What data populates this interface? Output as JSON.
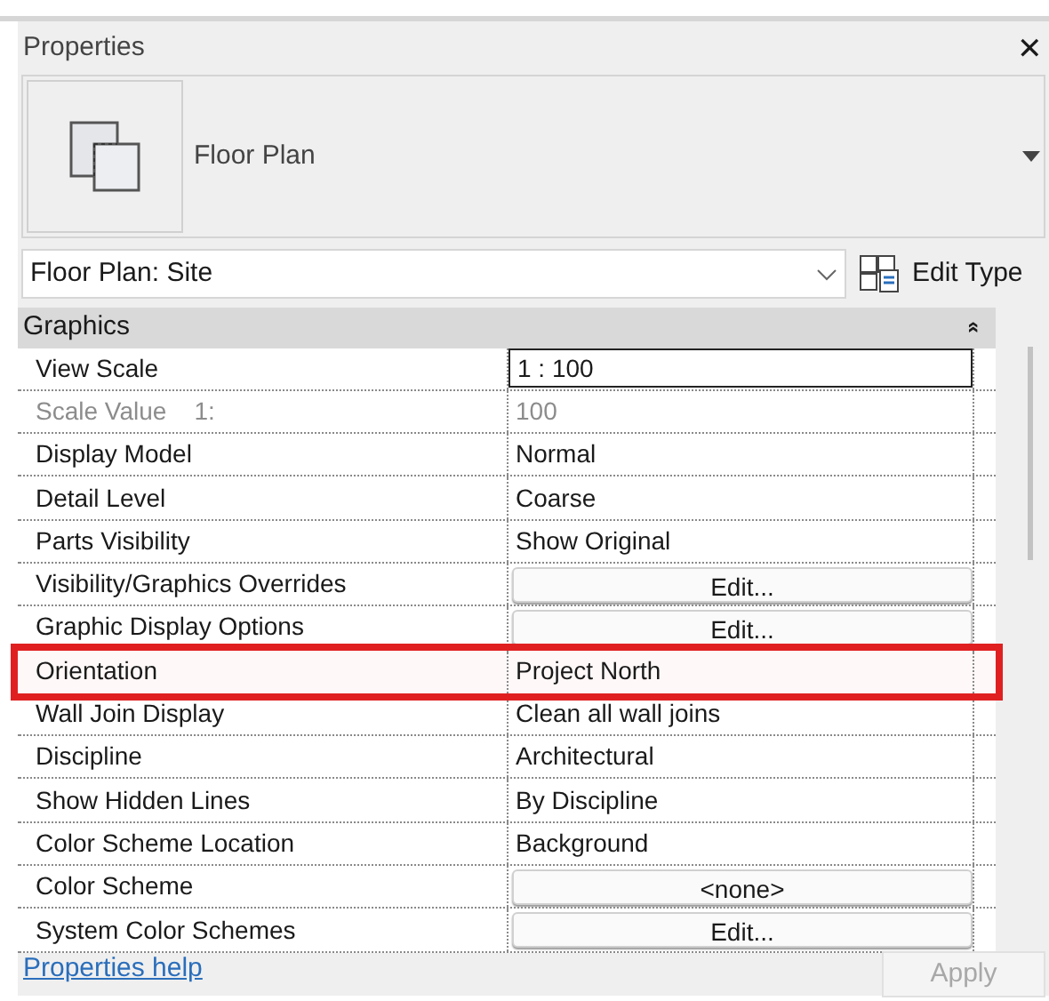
{
  "panel": {
    "title": "Properties",
    "close": "✕"
  },
  "type_selector": {
    "name": "Floor Plan"
  },
  "view_selector": {
    "value": "Floor Plan: Site"
  },
  "edit_type_button": {
    "label": "Edit Type"
  },
  "group": {
    "title": "Graphics",
    "expanded": true,
    "toggle": "»"
  },
  "properties": [
    {
      "name": "View Scale",
      "value": "1 : 100",
      "kind": "field",
      "disabled": false,
      "highlighted": false
    },
    {
      "name": "Scale Value    1:",
      "value": "100",
      "kind": "text",
      "disabled": true,
      "highlighted": false
    },
    {
      "name": "Display Model",
      "value": "Normal",
      "kind": "text",
      "disabled": false,
      "highlighted": false
    },
    {
      "name": "Detail Level",
      "value": "Coarse",
      "kind": "text",
      "disabled": false,
      "highlighted": false
    },
    {
      "name": "Parts Visibility",
      "value": "Show Original",
      "kind": "text",
      "disabled": false,
      "highlighted": false
    },
    {
      "name": "Visibility/Graphics Overrides",
      "value": "Edit...",
      "kind": "button",
      "disabled": false,
      "highlighted": false
    },
    {
      "name": "Graphic Display Options",
      "value": "Edit...",
      "kind": "button",
      "disabled": false,
      "highlighted": false
    },
    {
      "name": "Orientation",
      "value": "Project North",
      "kind": "text",
      "disabled": false,
      "highlighted": true
    },
    {
      "name": "Wall Join Display",
      "value": "Clean all wall joins",
      "kind": "text",
      "disabled": false,
      "highlighted": false
    },
    {
      "name": "Discipline",
      "value": "Architectural",
      "kind": "text",
      "disabled": false,
      "highlighted": false
    },
    {
      "name": "Show Hidden Lines",
      "value": "By Discipline",
      "kind": "text",
      "disabled": false,
      "highlighted": false
    },
    {
      "name": "Color Scheme Location",
      "value": "Background",
      "kind": "text",
      "disabled": false,
      "highlighted": false
    },
    {
      "name": "Color Scheme",
      "value": "<none>",
      "kind": "button",
      "disabled": false,
      "highlighted": false
    },
    {
      "name": "System Color Schemes",
      "value": "Edit...",
      "kind": "button",
      "disabled": false,
      "highlighted": false
    }
  ],
  "help_link": "Properties help",
  "apply_button": {
    "label": "Apply",
    "disabled": true
  }
}
